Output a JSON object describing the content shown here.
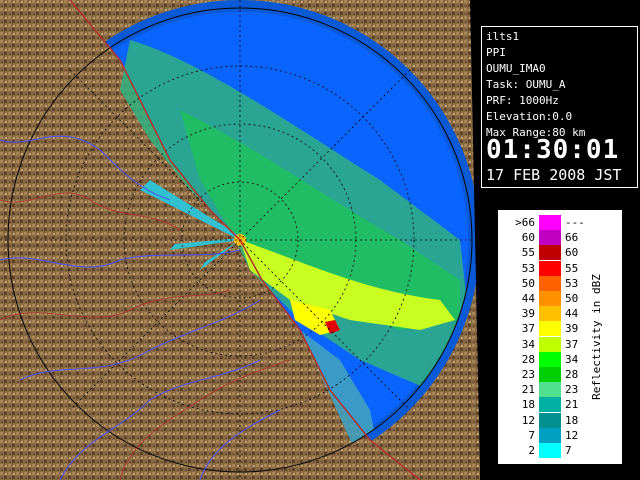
{
  "radar": {
    "station": "ilts1",
    "scan_type": "PPI",
    "product": "OUMU_IMA0",
    "task": "Task: OUMU_A",
    "prf": "PRF: 1000Hz",
    "elevation": "Elevation:0.0",
    "max_range": "Max Range:80 km",
    "time": "01:30:01",
    "date": "17 FEB 2008 JST"
  },
  "legend": {
    "unit_label": "Reflectivity in dBZ",
    "rows": [
      {
        "lo": ">66",
        "hi": "---",
        "color": "#ff00ff"
      },
      {
        "lo": "60",
        "hi": "66",
        "color": "#c000c0"
      },
      {
        "lo": "55",
        "hi": "60",
        "color": "#c00000"
      },
      {
        "lo": "53",
        "hi": "55",
        "color": "#ff0000"
      },
      {
        "lo": "50",
        "hi": "53",
        "color": "#ff6000"
      },
      {
        "lo": "44",
        "hi": "50",
        "color": "#ff9000"
      },
      {
        "lo": "39",
        "hi": "44",
        "color": "#ffc000"
      },
      {
        "lo": "37",
        "hi": "39",
        "color": "#ffff00"
      },
      {
        "lo": "34",
        "hi": "37",
        "color": "#c0ff00"
      },
      {
        "lo": "28",
        "hi": "34",
        "color": "#00ff00"
      },
      {
        "lo": "23",
        "hi": "28",
        "color": "#00d000"
      },
      {
        "lo": "21",
        "hi": "23",
        "color": "#50e090"
      },
      {
        "lo": "18",
        "hi": "21",
        "color": "#00b0a0"
      },
      {
        "lo": "12",
        "hi": "18",
        "color": "#009090"
      },
      {
        "lo": "7",
        "hi": "12",
        "color": "#00a0c0"
      },
      {
        "lo": "2",
        "hi": "7",
        "color": "#00ffff"
      }
    ]
  },
  "colors": {
    "range_ring_fill": "#0a64ff",
    "outer_ring": "#0a5ad8",
    "land": "#8a6a44",
    "coastline": "#b03030",
    "rivers": "#5050ff"
  }
}
